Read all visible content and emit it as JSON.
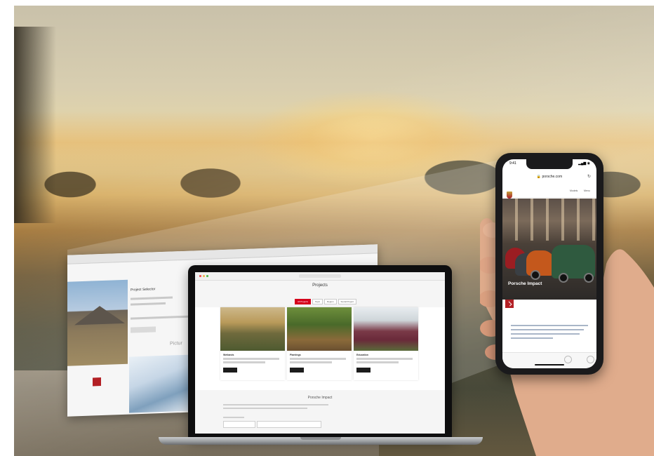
{
  "background": {
    "scene": "sunset-landscape-photo",
    "colors": {
      "sky": "#d8ceb0",
      "glow": "#f3cf86",
      "hills": "#4e4a34"
    }
  },
  "back_window": {
    "section_title": "Project Selector",
    "subtitle": "Pictur",
    "accent_color": "#b32025"
  },
  "laptop": {
    "page_title": "Projects",
    "tabs": [
      {
        "label": "All Projects",
        "active": true
      },
      {
        "label": "Topic",
        "active": false
      },
      {
        "label": "Region",
        "active": false
      },
      {
        "label": "Social Project",
        "active": false
      }
    ],
    "cards": [
      {
        "title": "Wetlands",
        "button_label": "Read more"
      },
      {
        "title": "Plantings",
        "button_label": "Read more"
      },
      {
        "title": "Education",
        "button_label": "Read more"
      }
    ],
    "section_title": "Porsche Impact",
    "accent_color": "#d5001c"
  },
  "phone": {
    "status_time": "9:41",
    "status_icons": "▂▄▆ ◉",
    "url": "🔒 porsche.com",
    "reload_icon": "↻",
    "menu_items": [
      "Models",
      "Menu"
    ],
    "hero_title": "Porsche Impact",
    "accent_color": "#b32025"
  }
}
